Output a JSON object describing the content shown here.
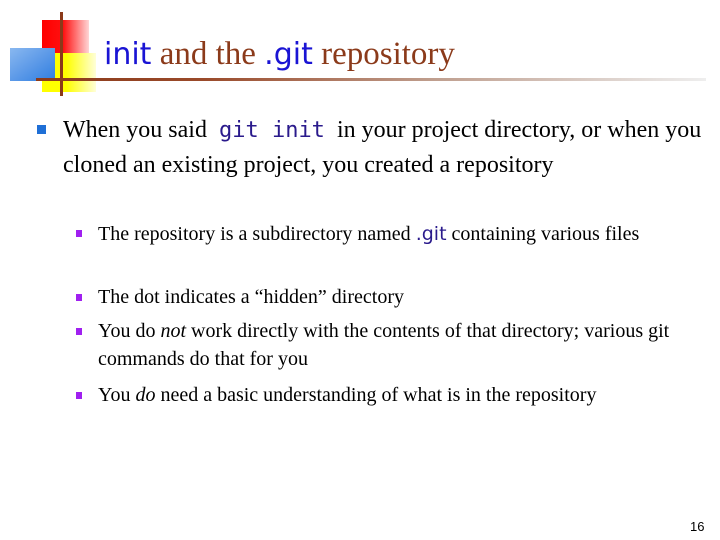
{
  "slide": {
    "title": {
      "part1_code": "init",
      "part2": " and the ",
      "part3_code": ".git",
      "part4": " repository"
    },
    "main_bullet": {
      "text_before": "When you said ",
      "code": "git init",
      "text_after": " in your project directory, or when you cloned an existing project, you created a repository"
    },
    "sub_bullets": [
      {
        "text_before": "The repository is a subdirectory named ",
        "code": ".git",
        "text_after": " containing various files"
      },
      {
        "text": "The dot indicates a “hidden” directory"
      },
      {
        "text_before": "You do ",
        "emphasis": "not",
        "text_after": " work directly with the contents of that directory; various git commands do that for you"
      },
      {
        "text_before": "You ",
        "emphasis": "do",
        "text_after": " need a basic understanding of what is in the repository"
      }
    ],
    "page_number": "16"
  },
  "colors": {
    "title_text": "#8b3a1a",
    "title_code": "#1a14d4",
    "body_code": "#2a1a8c",
    "main_bullet": "#1f6fd6",
    "sub_bullet": "#a020f0"
  }
}
